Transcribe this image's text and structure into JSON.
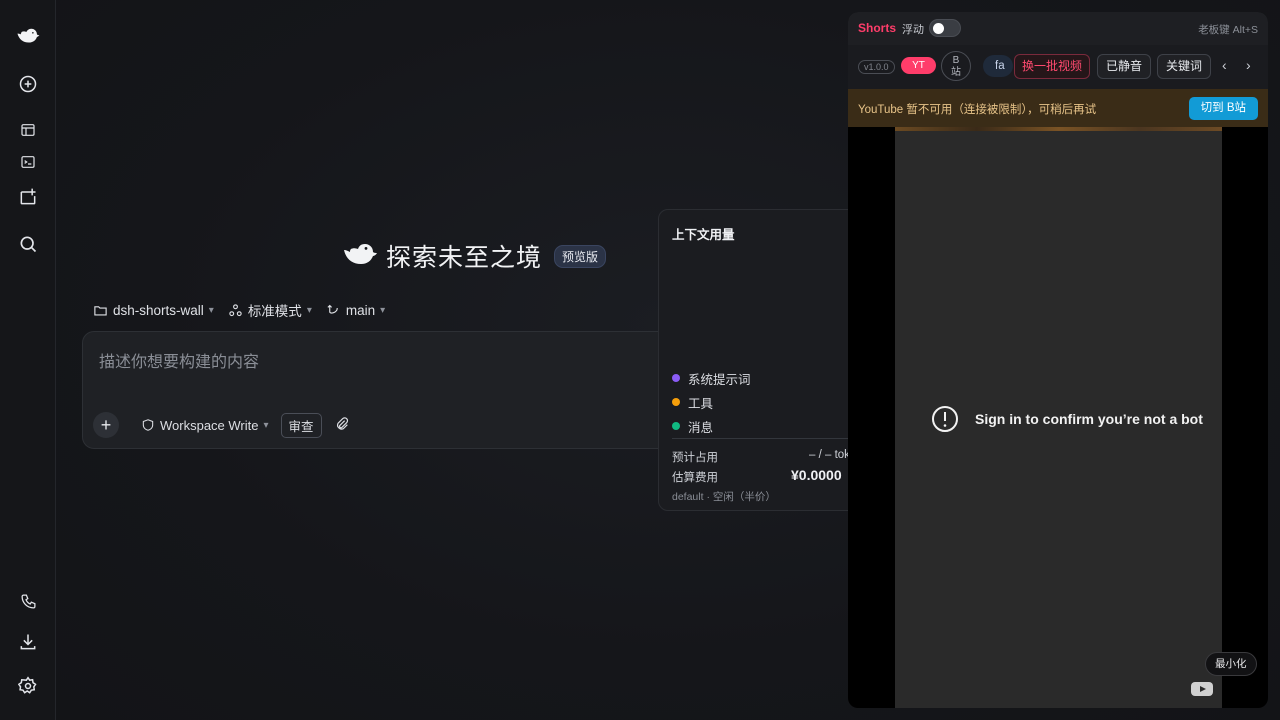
{
  "rail": {
    "items": [
      "logo",
      "new-chat",
      "layout",
      "terminal",
      "add-project",
      "search",
      "phone",
      "download",
      "settings"
    ]
  },
  "brand": {
    "title": "探索未至之境",
    "badge": "预览版"
  },
  "context": {
    "project": "dsh-shorts-wall",
    "mode": "标准模式",
    "branch": "main"
  },
  "composer": {
    "placeholder": "描述你想要构建的内容",
    "workspace": "Workspace Write",
    "review": "审查"
  },
  "usage": {
    "title": "上下文用量",
    "legend": [
      {
        "label": "系统提示词",
        "color": "#8b5cf6"
      },
      {
        "label": "工具",
        "color": "#f59e0b"
      },
      {
        "label": "消息",
        "color": "#10b981"
      }
    ],
    "estimate_label": "预计占用",
    "estimate_value": "– / – tok",
    "cost_label": "估算费用",
    "cost_value": "¥0.0000",
    "footer": "default · 空闲（半价）"
  },
  "shorts": {
    "name": "Shorts",
    "float_label": "浮动",
    "float_on": false,
    "boss_key": "老板键 Alt+S",
    "version": "v1.0.0",
    "source_yt": "YT",
    "source_b_line1": "B",
    "source_b_line2": "站",
    "fav_tag": "fa",
    "btn_refresh": "换一批视频",
    "btn_muted": "已静音",
    "btn_keywords": "关键词",
    "prev": "‹",
    "next": "›",
    "warning": "YouTube 暂不可用（连接被限制），可稍后再试",
    "switch_btn": "切到 B站",
    "video_message": "Sign in to confirm you’re not a bot",
    "minimize": "最小化"
  }
}
